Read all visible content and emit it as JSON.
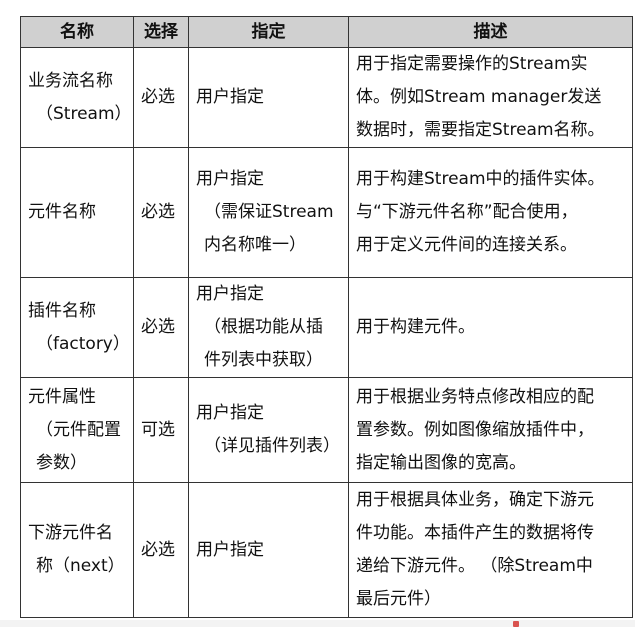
{
  "table": {
    "headers": [
      "名称",
      "选择",
      "指定",
      "描述"
    ],
    "rows": [
      {
        "name": [
          "业务流名称",
          "（Stream）"
        ],
        "choice": "必选",
        "spec": [
          "用户指定"
        ],
        "desc": [
          "用于指定需要操作的Stream实",
          "体。例如Stream manager发送",
          "数据时，需要指定Stream名称。"
        ]
      },
      {
        "name": [
          "元件名称"
        ],
        "choice": "必选",
        "spec": [
          "用户指定",
          "（需保证Stream",
          "内名称唯一）"
        ],
        "desc": [
          "用于构建Stream中的插件实体。",
          "与“下游元件名称”配合使用，",
          "用于定义元件间的连接关系。"
        ]
      },
      {
        "name": [
          "插件名称",
          "（factory）"
        ],
        "choice": "必选",
        "spec": [
          "用户指定",
          "（根据功能从插",
          "件列表中获取）"
        ],
        "desc": [
          "用于构建元件。"
        ]
      },
      {
        "name": [
          "元件属性",
          "（元件配置",
          "参数）"
        ],
        "choice": "可选",
        "spec": [
          "用户指定",
          "（详见插件列表）"
        ],
        "desc": [
          "用于根据业务特点修改相应的配",
          "置参数。例如图像缩放插件中，",
          "指定输出图像的宽高。"
        ]
      },
      {
        "name": [
          "下游元件名",
          "称（next）"
        ],
        "choice": "必选",
        "spec": [
          "用户指定"
        ],
        "desc": [
          "用于根据具体业务，确定下游元",
          "件功能。本插件产生的数据将传",
          "递给下游元件。 （除Stream中",
          "最后元件）"
        ]
      }
    ]
  }
}
